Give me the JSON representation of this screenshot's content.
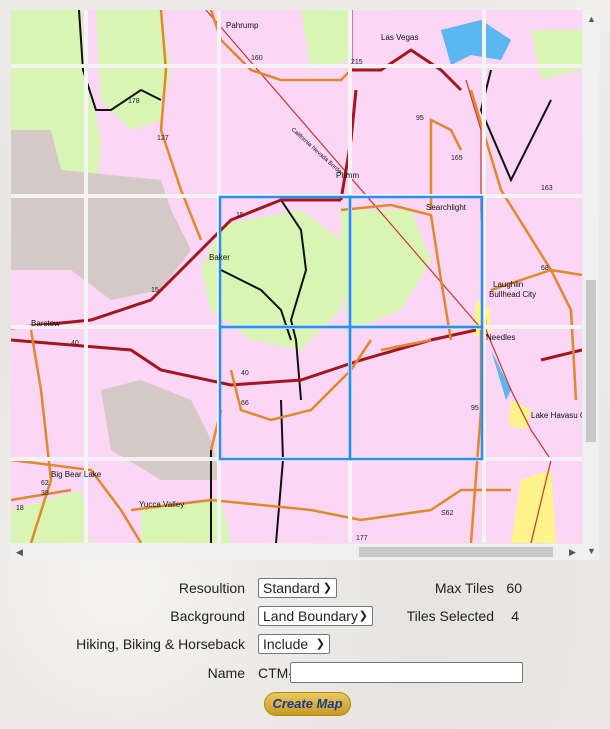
{
  "map": {
    "place_labels": [
      "Pahrump",
      "Las Vegas",
      "Primm",
      "Searchlight",
      "Baker",
      "Barstow",
      "Laughlin",
      "Bullhead City",
      "Needles",
      "Lake Havasu City",
      "Big Bear Lake",
      "Yucca Valley",
      "California Nevada Border"
    ],
    "route_labels": [
      "15",
      "40",
      "95",
      "66",
      "S62",
      "127",
      "178",
      "160",
      "215",
      "165",
      "163",
      "68",
      "177",
      "62",
      "38",
      "18"
    ],
    "grid_columns": 5,
    "grid_rows": 5,
    "selected_tiles": [
      [
        2,
        2
      ],
      [
        3,
        2
      ],
      [
        2,
        3
      ],
      [
        3,
        3
      ]
    ],
    "selection_color": "#2b8ef0"
  },
  "form": {
    "resolution_label": "Resoultion",
    "resolution_value": "Standard",
    "background_label": "Background",
    "background_value": "Land Boundary",
    "hiking_label": "Hiking, Biking & Horseback",
    "hiking_value": "Include",
    "name_label": "Name",
    "name_prefix": "CTM-",
    "name_value": "",
    "max_tiles_label": "Max Tiles",
    "max_tiles_value": "60",
    "tiles_selected_label": "Tiles Selected",
    "tiles_selected_value": "4",
    "create_button": "Create Map"
  }
}
